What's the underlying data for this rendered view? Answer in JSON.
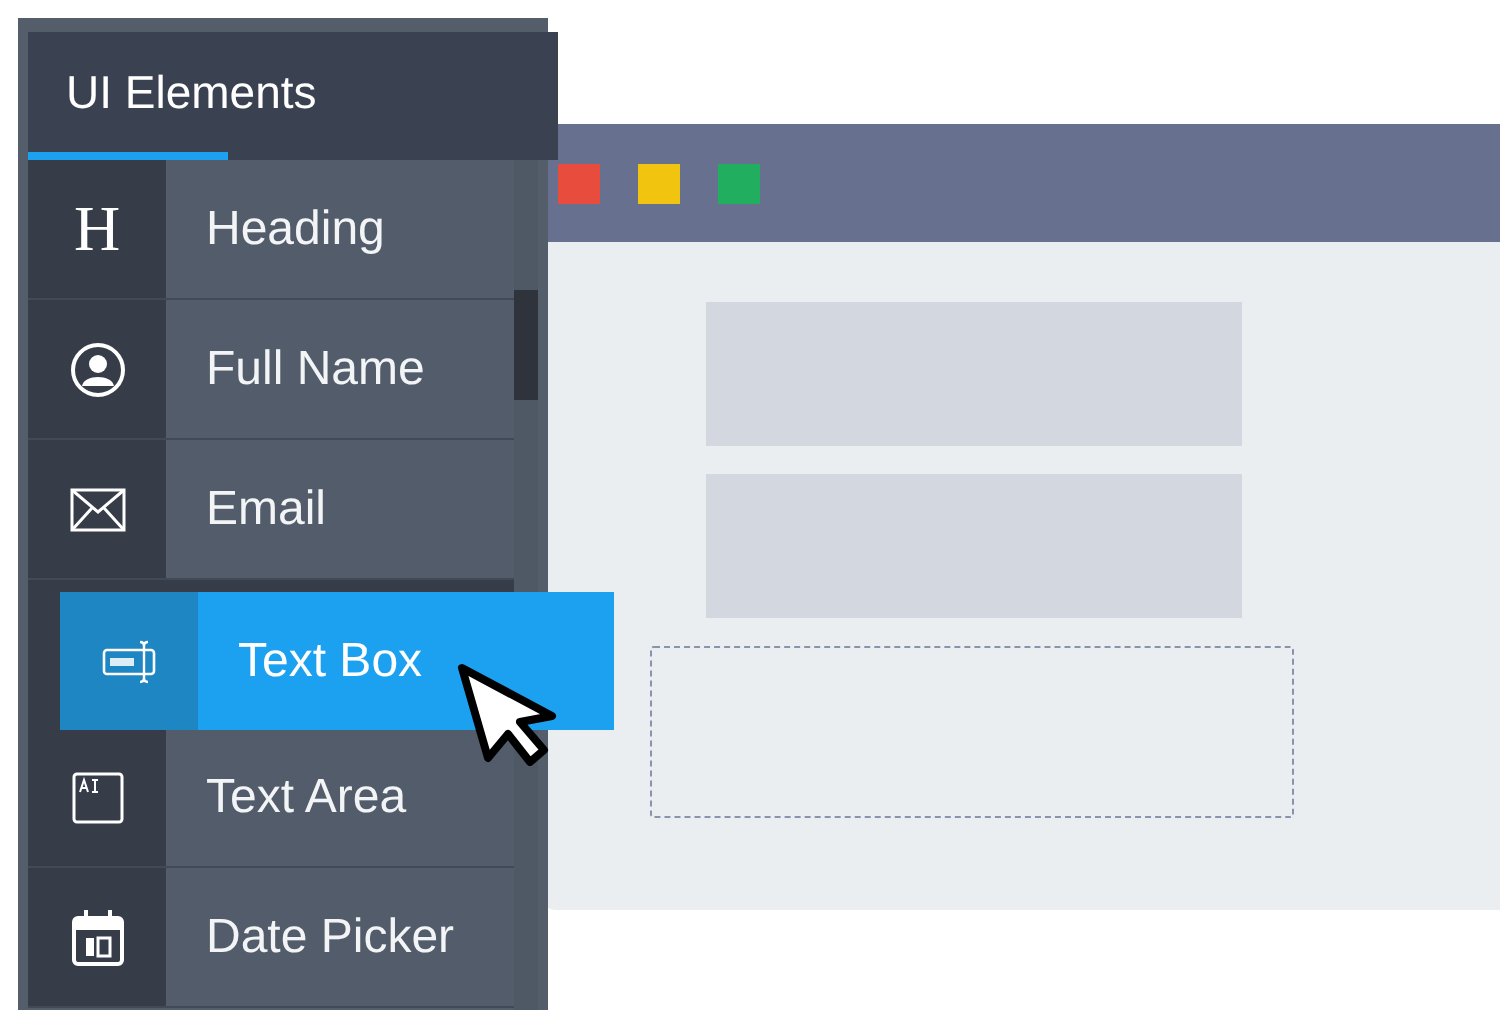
{
  "panel": {
    "tab": {
      "label": "UI Elements",
      "selected": true
    },
    "items": [
      {
        "kind": "heading",
        "glyph": "H",
        "label": "Heading",
        "dragging": false
      },
      {
        "kind": "person",
        "label": "Full Name",
        "dragging": false
      },
      {
        "kind": "email",
        "label": "Email",
        "dragging": false
      },
      {
        "kind": "textbox",
        "label": "Text Box",
        "dragging": true
      },
      {
        "kind": "textarea",
        "label": "Text Area",
        "dragging": false
      },
      {
        "kind": "date",
        "label": "Date Picker",
        "dragging": false
      }
    ]
  }
}
